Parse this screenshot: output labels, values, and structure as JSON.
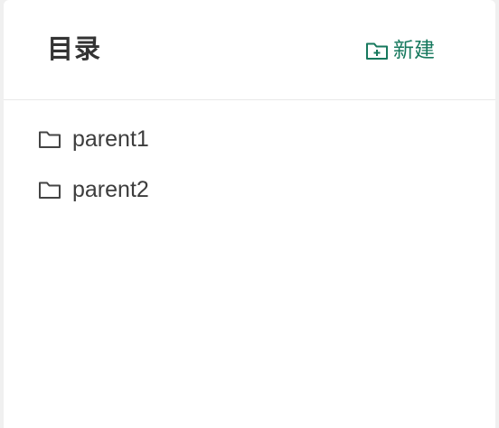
{
  "header": {
    "title": "目录",
    "new_button": {
      "label": "新建",
      "icon": "folder-add-icon"
    }
  },
  "tree": {
    "items": [
      {
        "label": "parent1",
        "icon": "folder-icon"
      },
      {
        "label": "parent2",
        "icon": "folder-icon"
      }
    ]
  },
  "colors": {
    "accent": "#17795e",
    "text": "#3d3d3d",
    "title": "#333333",
    "divider": "#e9e9e9"
  }
}
